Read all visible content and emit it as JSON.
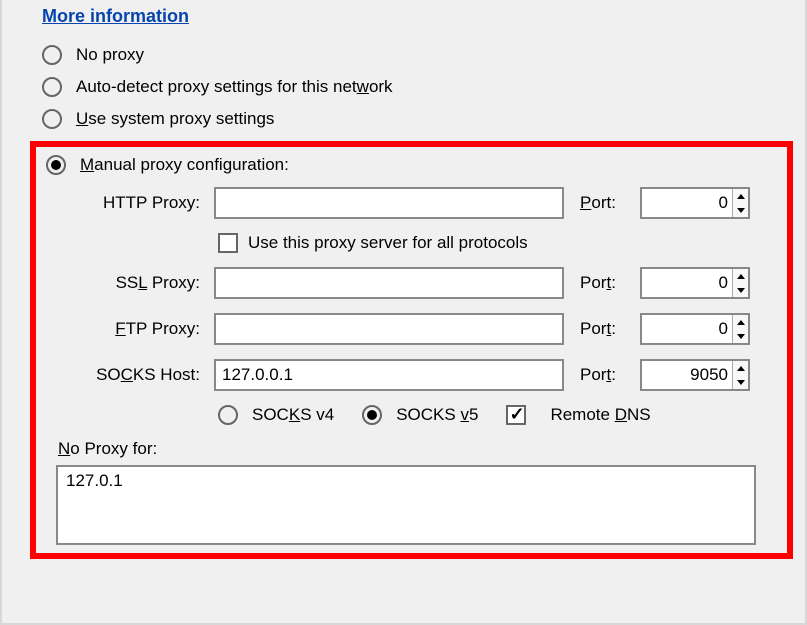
{
  "link": {
    "more_info": "More information"
  },
  "proxy_mode": {
    "no_proxy": "No proxy",
    "auto_detect": "Auto-detect proxy settings for this net",
    "auto_detect_u": "w",
    "auto_detect_end": "ork",
    "system_pre": "",
    "system_u": "U",
    "system_post": "se system proxy settings",
    "manual_u": "M",
    "manual_post": "anual proxy configuration:"
  },
  "labels": {
    "http": "HTTP Proxy:",
    "ssl_pre": "SS",
    "ssl_u": "L",
    "ssl_post": " Proxy:",
    "ftp_u": "F",
    "ftp_post": "TP Proxy:",
    "socks_pre": "SO",
    "socks_u": "C",
    "socks_post": "KS Host:",
    "port": "P",
    "port_u": "o",
    "port_post": "rt:",
    "port_plain": "Por",
    "port_t_u": "t",
    "port_colon": ":",
    "use_all": "Use this proxy server for all protocols",
    "socks4_pre": "SOC",
    "socks4_u": "K",
    "socks4_post": "S v4",
    "socks5_pre": "SOCKS ",
    "socks5_u": "v",
    "socks5_post": "5",
    "remote_dns_pre": "Remote ",
    "remote_dns_u": "D",
    "remote_dns_post": "NS",
    "no_proxy_for_u": "N",
    "no_proxy_for_post": "o Proxy for:"
  },
  "values": {
    "http_host": "",
    "http_port": "0",
    "ssl_host": "",
    "ssl_port": "0",
    "ftp_host": "",
    "ftp_port": "0",
    "socks_host": "127.0.0.1",
    "socks_port": "9050",
    "no_proxy": "127.0.1"
  }
}
